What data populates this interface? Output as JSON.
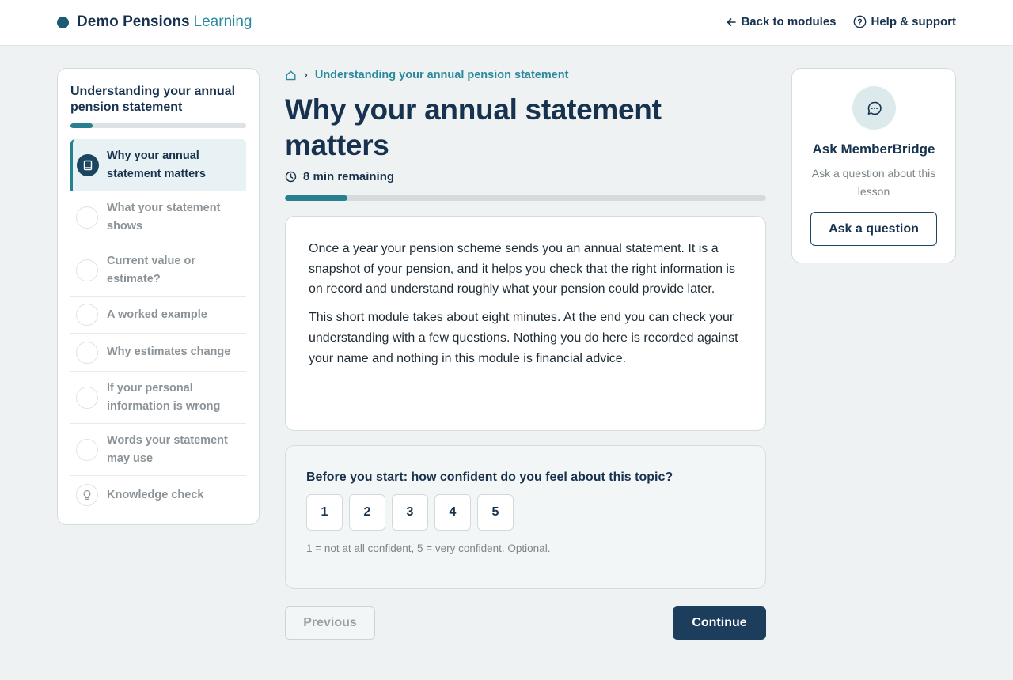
{
  "header": {
    "brand_name": "Demo Pensions",
    "brand_sub": "Learning",
    "back_label": "Back to modules",
    "help_label": "Help & support"
  },
  "sidebar": {
    "module_title": "Understanding your annual pension statement",
    "progress_fraction": 0.125,
    "items": [
      {
        "label": "Why your annual statement matters",
        "state": "active"
      },
      {
        "label": "What your statement shows",
        "state": "pending"
      },
      {
        "label": "Current value or estimate?",
        "state": "pending"
      },
      {
        "label": "A worked example",
        "state": "pending"
      },
      {
        "label": "Why estimates change",
        "state": "pending"
      },
      {
        "label": "If your personal information is wrong",
        "state": "pending"
      },
      {
        "label": "Words your statement may use",
        "state": "pending"
      },
      {
        "label": "Knowledge check",
        "state": "quiz"
      }
    ]
  },
  "main": {
    "breadcrumb": "Understanding your annual pension statement",
    "title": "Why your annual statement matters",
    "remaining": "8 min remaining",
    "progress_fraction": 0.13,
    "paragraphs": [
      "Once a year your pension scheme sends you an annual statement. It is a snapshot of your pension, and it helps you check that the right information is on record and understand roughly what your pension could provide later.",
      "This short module takes about eight minutes. At the end you can check your understanding with a few questions. Nothing you do here is recorded against your name and nothing in this module is financial advice."
    ],
    "confidence": {
      "question": "Before you start: how confident do you feel about this topic?",
      "options": [
        "1",
        "2",
        "3",
        "4",
        "5"
      ],
      "hint": "1 = not at all confident, 5 = very confident. Optional."
    },
    "previous_label": "Previous",
    "continue_label": "Continue"
  },
  "ask": {
    "title": "Ask MemberBridge",
    "subtitle": "Ask a question about this lesson",
    "button_label": "Ask a question"
  },
  "icons": {
    "brand": "brand-dot",
    "back": "arrow-left-icon",
    "help": "help-circle-icon",
    "home": "home-icon",
    "clock": "clock-icon",
    "lesson": "book-icon",
    "quiz": "lightbulb-icon",
    "chat": "chat-bubble-icon"
  },
  "colors": {
    "accent": "#27808f",
    "primary": "#1c3d5c",
    "brand_dot": "#1b5a73"
  }
}
